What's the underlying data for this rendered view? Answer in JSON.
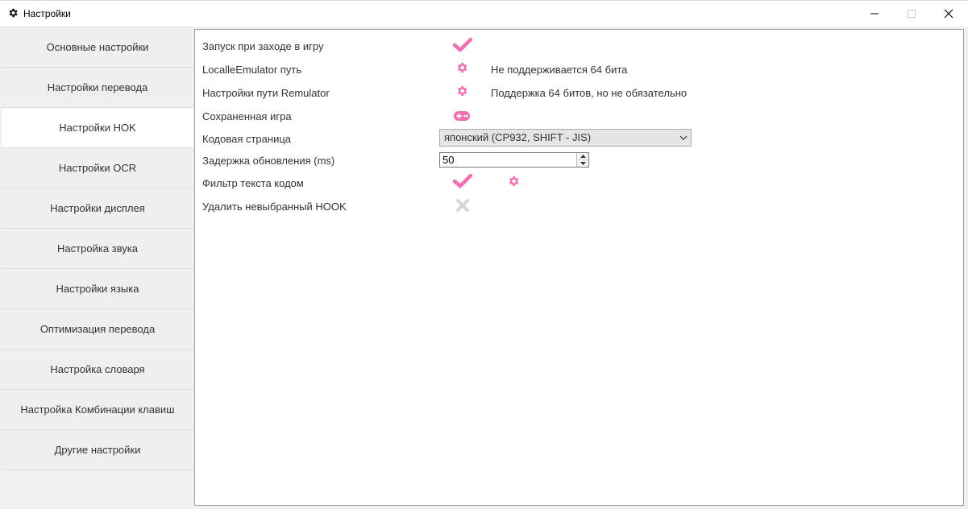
{
  "window": {
    "title": "Настройки",
    "icon": "gear-icon",
    "controls": [
      "minimize-icon",
      "maximize-icon",
      "close-icon"
    ]
  },
  "colors": {
    "accent": "#f36fb0",
    "disabled": "#d6d6d6"
  },
  "sidebar": {
    "active_index": 2,
    "items": [
      {
        "label": "Основные настройки"
      },
      {
        "label": "Настройки перевода"
      },
      {
        "label": "Настройки HOK"
      },
      {
        "label": "Настройки OCR"
      },
      {
        "label": "Настройки дисплея"
      },
      {
        "label": "Настройка звука"
      },
      {
        "label": "Настройки языка"
      },
      {
        "label": "Оптимизация перевода"
      },
      {
        "label": "Настройка словаря"
      },
      {
        "label": "Настройка Комбинации клавиш"
      },
      {
        "label": "Другие настройки"
      }
    ]
  },
  "settings": {
    "launch_on_game": {
      "label": "Запуск при заходе в игру",
      "checked": true,
      "icon": "check-icon"
    },
    "locale_emulator": {
      "label": "LocalleEmulator путь",
      "icon": "gear-icon",
      "note": "Не поддерживается 64 бита"
    },
    "remulator": {
      "label": "Настройки пути Remulator",
      "icon": "gear-icon",
      "note": "Поддержка 64 битов, но не обязательно"
    },
    "saved_game": {
      "label": "Сохраненная игра",
      "icon": "gamepad-icon"
    },
    "code_page": {
      "label": "Кодовая страница",
      "value": "японский (CP932, SHIFT - JIS)"
    },
    "refresh_delay": {
      "label": "Задержка обновления (ms)",
      "value": "50"
    },
    "text_filter": {
      "label": "Фильтр текста кодом",
      "checked": true,
      "icon": "check-icon",
      "settings_icon": "gear-icon"
    },
    "remove_unselected_hook": {
      "label": "Удалить невыбранный HOOK",
      "checked": false,
      "icon": "x-icon"
    }
  }
}
